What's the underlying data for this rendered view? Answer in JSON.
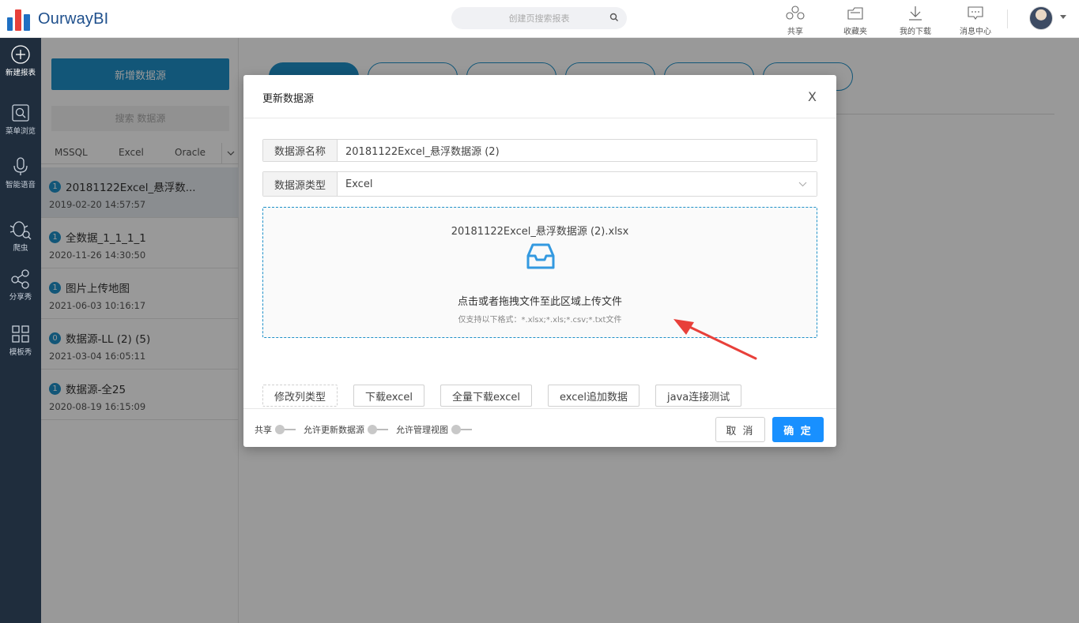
{
  "app": {
    "name": "OurwayBI"
  },
  "header": {
    "search_placeholder": "创建页搜索报表",
    "actions": [
      {
        "label": "共享",
        "icon": "share-cloud-icon"
      },
      {
        "label": "收藏夹",
        "icon": "folder-icon"
      },
      {
        "label": "我的下载",
        "icon": "download-icon"
      },
      {
        "label": "消息中心",
        "icon": "message-icon"
      }
    ]
  },
  "leftnav": {
    "items": [
      {
        "label": "新建报表",
        "icon": "plus-circle-icon"
      },
      {
        "label": "菜单浏览",
        "icon": "browse-icon"
      },
      {
        "label": "智能语音",
        "icon": "microphone-icon"
      },
      {
        "label": "爬虫",
        "icon": "bug-icon"
      },
      {
        "label": "分享秀",
        "icon": "share-nodes-icon"
      },
      {
        "label": "模板秀",
        "icon": "grid-icon"
      }
    ]
  },
  "datasource_panel": {
    "add_button": "新增数据源",
    "search_placeholder": "搜索 数据源",
    "tabs": [
      "MSSQL",
      "Excel",
      "Oracle"
    ],
    "more_icon": "chevron-down-icon",
    "items": [
      {
        "badge": "1",
        "name": "20181122Excel_悬浮数...",
        "date": "2019-02-20 14:57:57",
        "selected": true
      },
      {
        "badge": "1",
        "name": "全数据_1_1_1_1",
        "date": "2020-11-26 14:30:50"
      },
      {
        "badge": "1",
        "name": "图片上传地图",
        "date": "2021-06-03 10:16:17"
      },
      {
        "badge": "0",
        "name": "数据源-LL (2) (5)",
        "date": "2021-03-04 16:05:11"
      },
      {
        "badge": "1",
        "name": "数据源-全25",
        "date": "2020-08-19 16:15:09"
      }
    ]
  },
  "modal": {
    "title": "更新数据源",
    "close": "X",
    "name_label": "数据源名称",
    "name_value": "20181122Excel_悬浮数据源 (2)",
    "type_label": "数据源类型",
    "type_value": "Excel",
    "upload": {
      "file_name": "20181122Excel_悬浮数据源 (2).xlsx",
      "hint": "点击或者拖拽文件至此区域上传文件",
      "sub_hint": "仅支持以下格式：*.xlsx;*.xls;*.csv;*.txt文件"
    },
    "actions": [
      "修改列类型",
      "下载excel",
      "全量下载excel",
      "excel追加数据",
      "java连接测试"
    ],
    "switches": [
      "共享",
      "允许更新数据源",
      "允许管理视图"
    ],
    "cancel": "取 消",
    "ok": "确 定"
  },
  "colors": {
    "primary": "#1890ff",
    "accent": "#1e90c8",
    "nav_bg": "#1f2d3d",
    "annotation_arrow": "#e8403a"
  }
}
